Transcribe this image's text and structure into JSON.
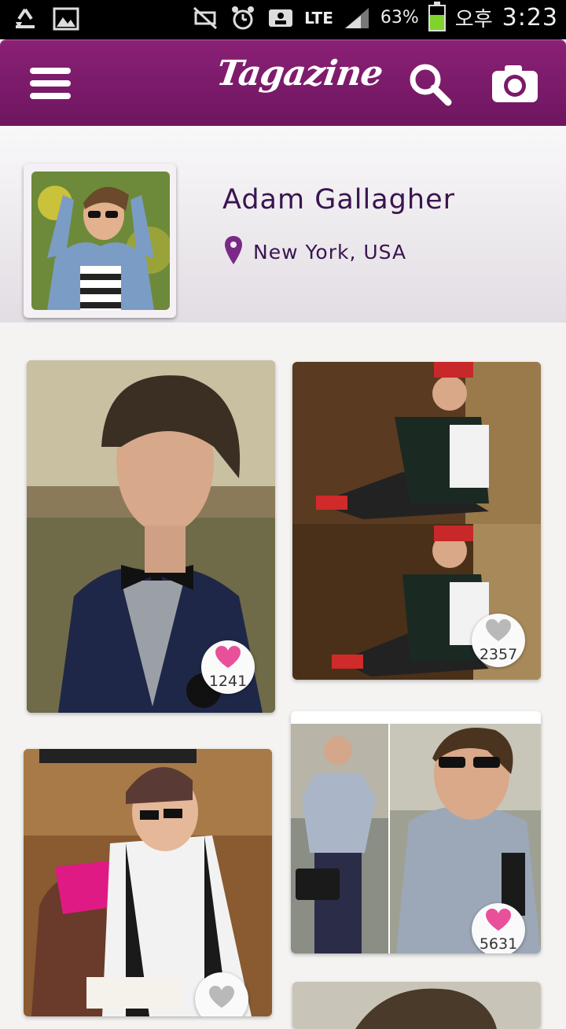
{
  "status_bar": {
    "battery_percent": "63%",
    "battery_level": 0.63,
    "network": "LTE",
    "ampm": "오후",
    "time": "3:23"
  },
  "app_bar": {
    "logo": "Tagazine",
    "icons": [
      "menu-icon",
      "search-icon",
      "camera-icon"
    ]
  },
  "profile": {
    "name": "Adam Gallagher",
    "location": "New York, USA"
  },
  "posts": [
    {
      "likes": "1241",
      "liked": true
    },
    {
      "likes": "2357",
      "liked": false
    },
    {
      "likes": "",
      "liked": false
    },
    {
      "likes": "5631",
      "liked": true
    }
  ],
  "colors": {
    "accent": "#7a1a6a",
    "liked_heart": "#e8519a",
    "unliked_heart": "#b9b9b9"
  }
}
